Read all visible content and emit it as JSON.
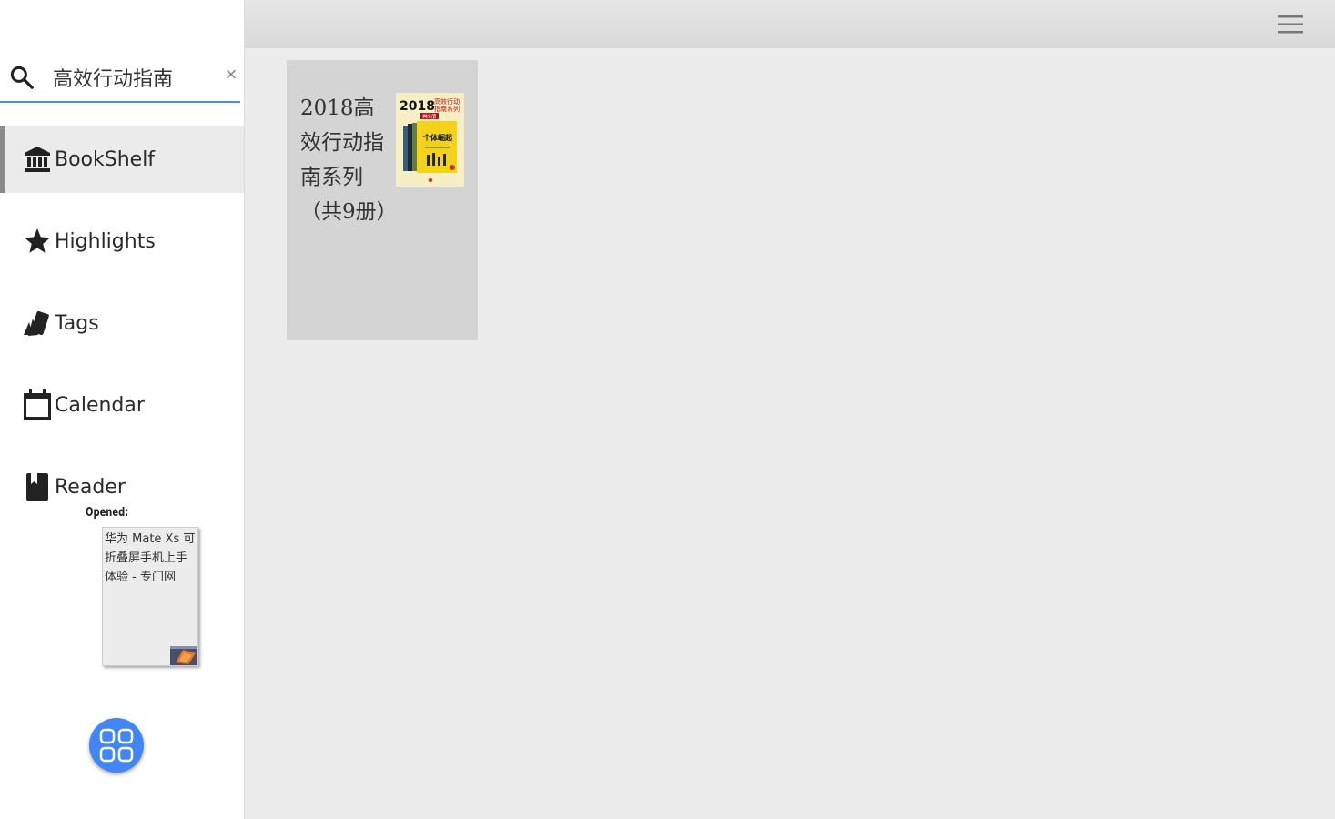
{
  "search": {
    "value": "高效行动指南",
    "clear_label": "×"
  },
  "nav": [
    {
      "label": "BookShelf",
      "icon": "bookshelf-icon",
      "active": true
    },
    {
      "label": "Highlights",
      "icon": "star-icon",
      "active": false
    },
    {
      "label": "Tags",
      "icon": "tags-icon",
      "active": false
    },
    {
      "label": "Calendar",
      "icon": "calendar-icon",
      "active": false
    },
    {
      "label": "Reader",
      "icon": "bookmark-icon",
      "active": false
    }
  ],
  "opened": {
    "label": "Opened:",
    "title": "华为 Mate Xs 可折叠屏手机上手体验 - 专门网"
  },
  "books": [
    {
      "title": "2018高效行动指南系列（共9册）",
      "cover_text": "2018 高效行动指南系列",
      "cover_badge": "共9册",
      "cover_subtitle": "个体崛起"
    }
  ],
  "colors": {
    "accent": "#4285f4",
    "search_underline": "#4a90e2",
    "cover_yellow": "#f2d31a"
  }
}
